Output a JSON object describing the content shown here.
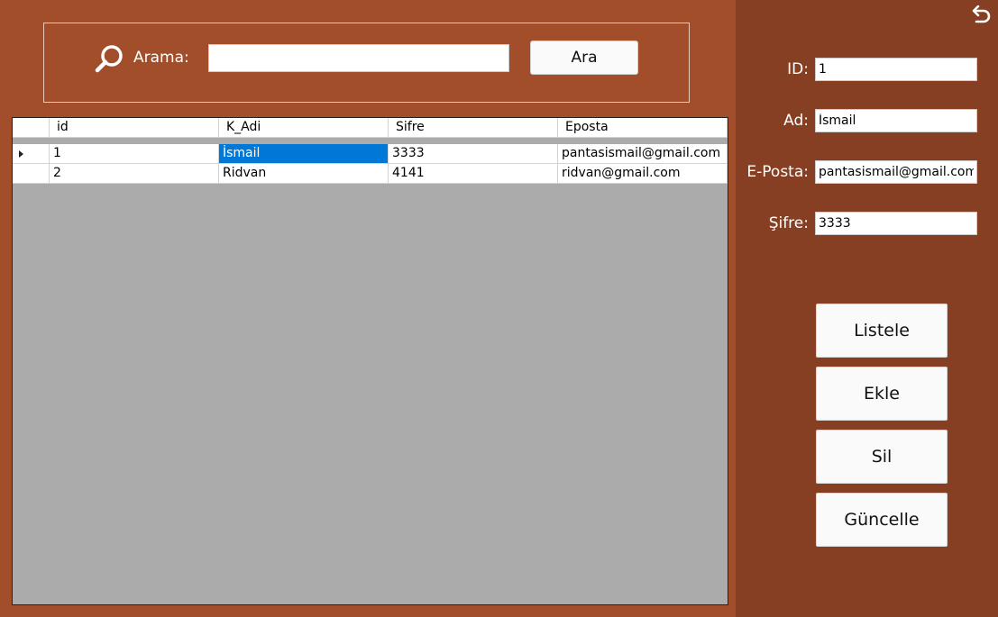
{
  "search": {
    "label": "Arama:",
    "value": "",
    "button_label": "Ara",
    "icon": "search-icon"
  },
  "grid": {
    "columns": [
      "id",
      "K_Adi",
      "Sifre",
      "Eposta"
    ],
    "rows": [
      [
        "1",
        "İsmail",
        "3333",
        "pantasismail@gmail.com"
      ],
      [
        "2",
        "Ridvan",
        "4141",
        "ridvan@gmail.com"
      ]
    ],
    "selected_row": 0,
    "selected_col": 1
  },
  "form": {
    "id_label": "ID:",
    "id_value": "1",
    "ad_label": "Ad:",
    "ad_value": "İsmail",
    "eposta_label": "E-Posta:",
    "eposta_value": "pantasismail@gmail.com",
    "sifre_label": "Şifre:",
    "sifre_value": "3333"
  },
  "actions": {
    "listele": "Listele",
    "ekle": "Ekle",
    "sil": "Sil",
    "guncelle": "Güncelle"
  },
  "colors": {
    "main_bg": "#a34e2b",
    "side_bg": "#863f22",
    "grid_bg": "#ababab",
    "selection": "#0078d7"
  },
  "icons": {
    "back": "undo-arrow-icon"
  }
}
